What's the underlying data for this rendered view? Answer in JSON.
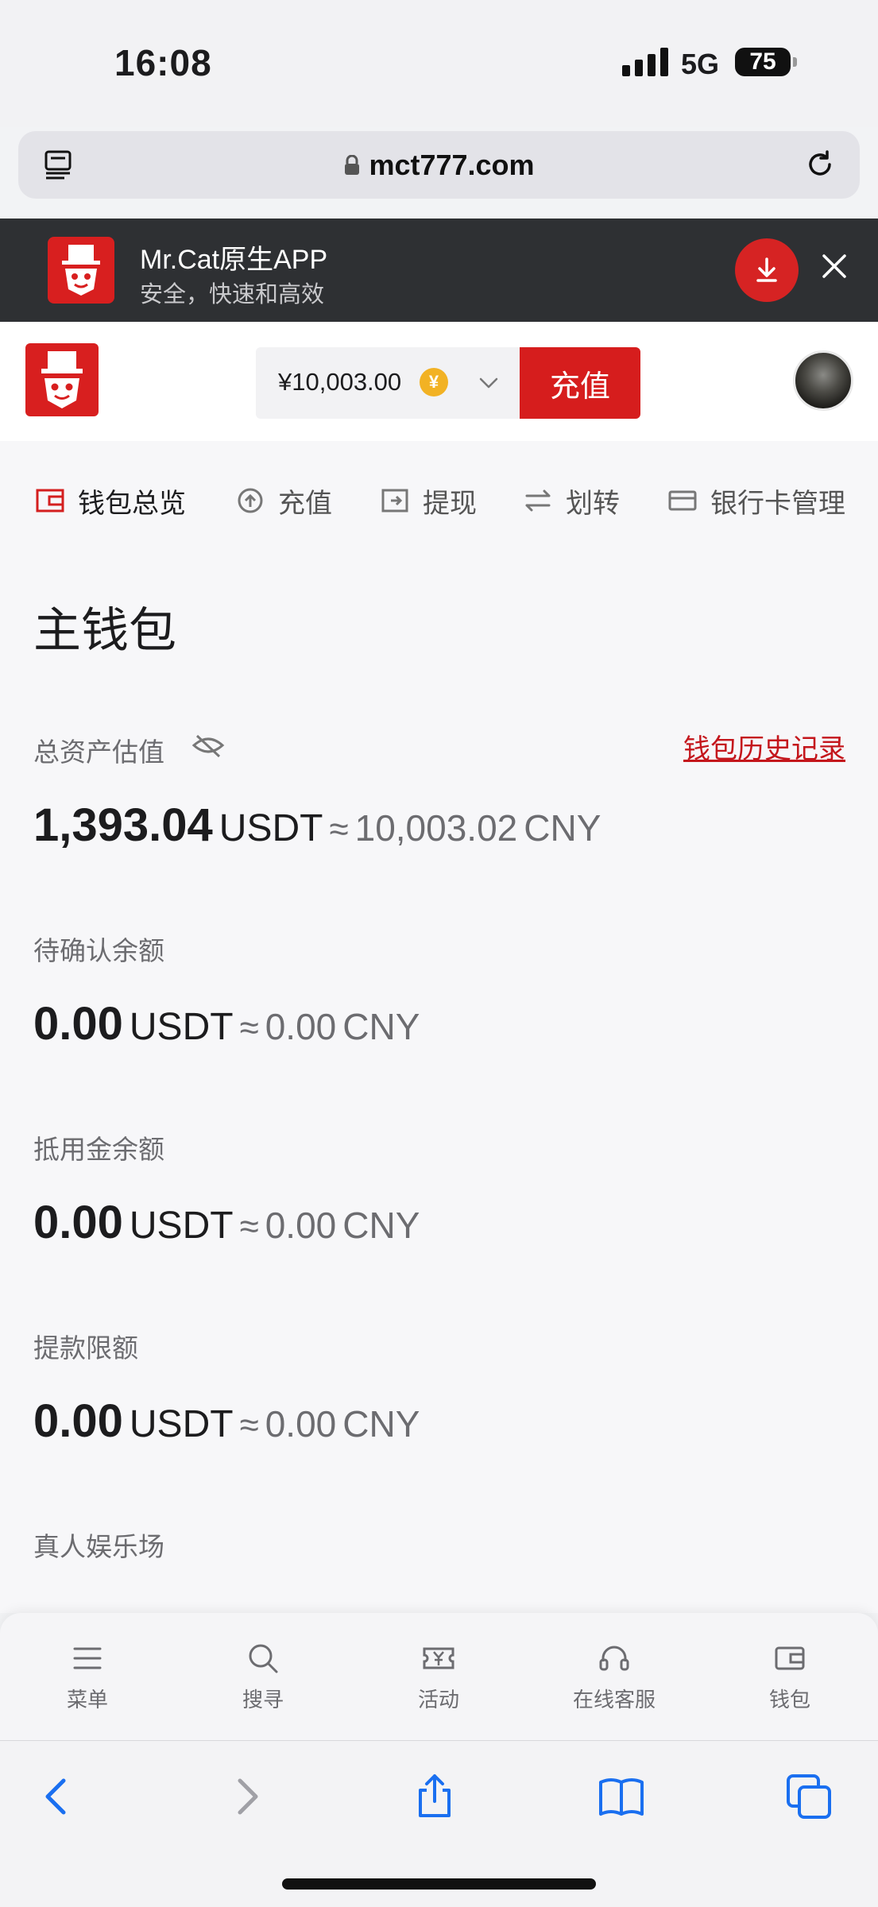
{
  "status_bar": {
    "time": "16:08",
    "network": "5G",
    "battery": "75"
  },
  "browser": {
    "url": "mct777.com",
    "reader_icon": "reader-mode-icon",
    "reload_icon": "reload-icon"
  },
  "app_banner": {
    "title": "Mr.Cat原生APP",
    "subtitle": "安全，快速和高效",
    "download_icon": "download-icon",
    "close_icon": "close-icon"
  },
  "header": {
    "balance": "¥10,003.00",
    "coin_symbol": "¥",
    "recharge_label": "充值"
  },
  "tabs": [
    {
      "label": "钱包总览",
      "icon": "wallet-icon",
      "active": true
    },
    {
      "label": "充值",
      "icon": "deposit-icon",
      "active": false
    },
    {
      "label": "提现",
      "icon": "withdraw-icon",
      "active": false
    },
    {
      "label": "划转",
      "icon": "transfer-icon",
      "active": false
    },
    {
      "label": "银行卡管理",
      "icon": "card-icon",
      "active": false
    }
  ],
  "wallet": {
    "title": "主钱包",
    "history_link": "钱包历史记录",
    "total": {
      "label": "总资产估值",
      "usdt": "1,393.04",
      "usdt_unit": "USDT",
      "approx": "≈",
      "cny": "10,003.02",
      "cny_unit": "CNY"
    },
    "pending": {
      "label": "待确认余额",
      "usdt": "0.00",
      "usdt_unit": "USDT",
      "approx": "≈",
      "cny": "0.00",
      "cny_unit": "CNY"
    },
    "voucher": {
      "label": "抵用金余额",
      "usdt": "0.00",
      "usdt_unit": "USDT",
      "approx": "≈",
      "cny": "0.00",
      "cny_unit": "CNY"
    },
    "withdraw_limit": {
      "label": "提款限额",
      "usdt": "0.00",
      "usdt_unit": "USDT",
      "approx": "≈",
      "cny": "0.00",
      "cny_unit": "CNY"
    },
    "live_casino": {
      "label": "真人娱乐场"
    }
  },
  "site_nav": [
    {
      "label": "菜单",
      "icon": "menu-icon"
    },
    {
      "label": "搜寻",
      "icon": "search-icon"
    },
    {
      "label": "活动",
      "icon": "ticket-icon"
    },
    {
      "label": "在线客服",
      "icon": "headset-icon"
    },
    {
      "label": "钱包",
      "icon": "wallet-icon"
    }
  ],
  "colors": {
    "brand_red": "#d61d1d",
    "link_red": "#c4161c",
    "banner_bg": "#2e3033",
    "ios_blue": "#1a6ff0"
  }
}
